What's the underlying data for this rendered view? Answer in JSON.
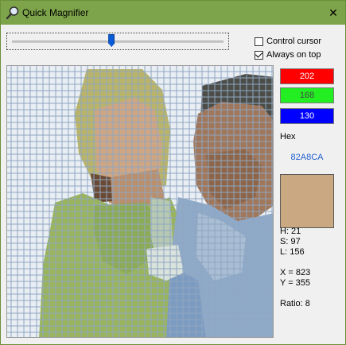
{
  "window": {
    "title": "Quick Magnifier",
    "close_glyph": "✕"
  },
  "toolbar": {
    "zoom_level": 0.47,
    "control_cursor_label": "Control cursor",
    "control_cursor_checked": false,
    "always_on_top_label": "Always on top",
    "always_on_top_checked": true
  },
  "color": {
    "r": "202",
    "g": "168",
    "b": "130",
    "hex_label": "Hex",
    "hex_value": "82A8CA",
    "swatch_color": "#caa882",
    "h": "H: 21",
    "s": "S: 97",
    "l": "L: 156",
    "x": "X = 823",
    "y": "Y = 355",
    "ratio": "Ratio: 8"
  },
  "colors": {
    "titlebar": "#7da44a",
    "red_box": "#ff0000",
    "green_box": "#22ee22",
    "blue_box": "#0000ff",
    "grid_line": "#8fa6c0",
    "hex_text": "#1e5fd0"
  },
  "icons": {
    "title": "magnifier-icon",
    "close": "close-icon"
  }
}
